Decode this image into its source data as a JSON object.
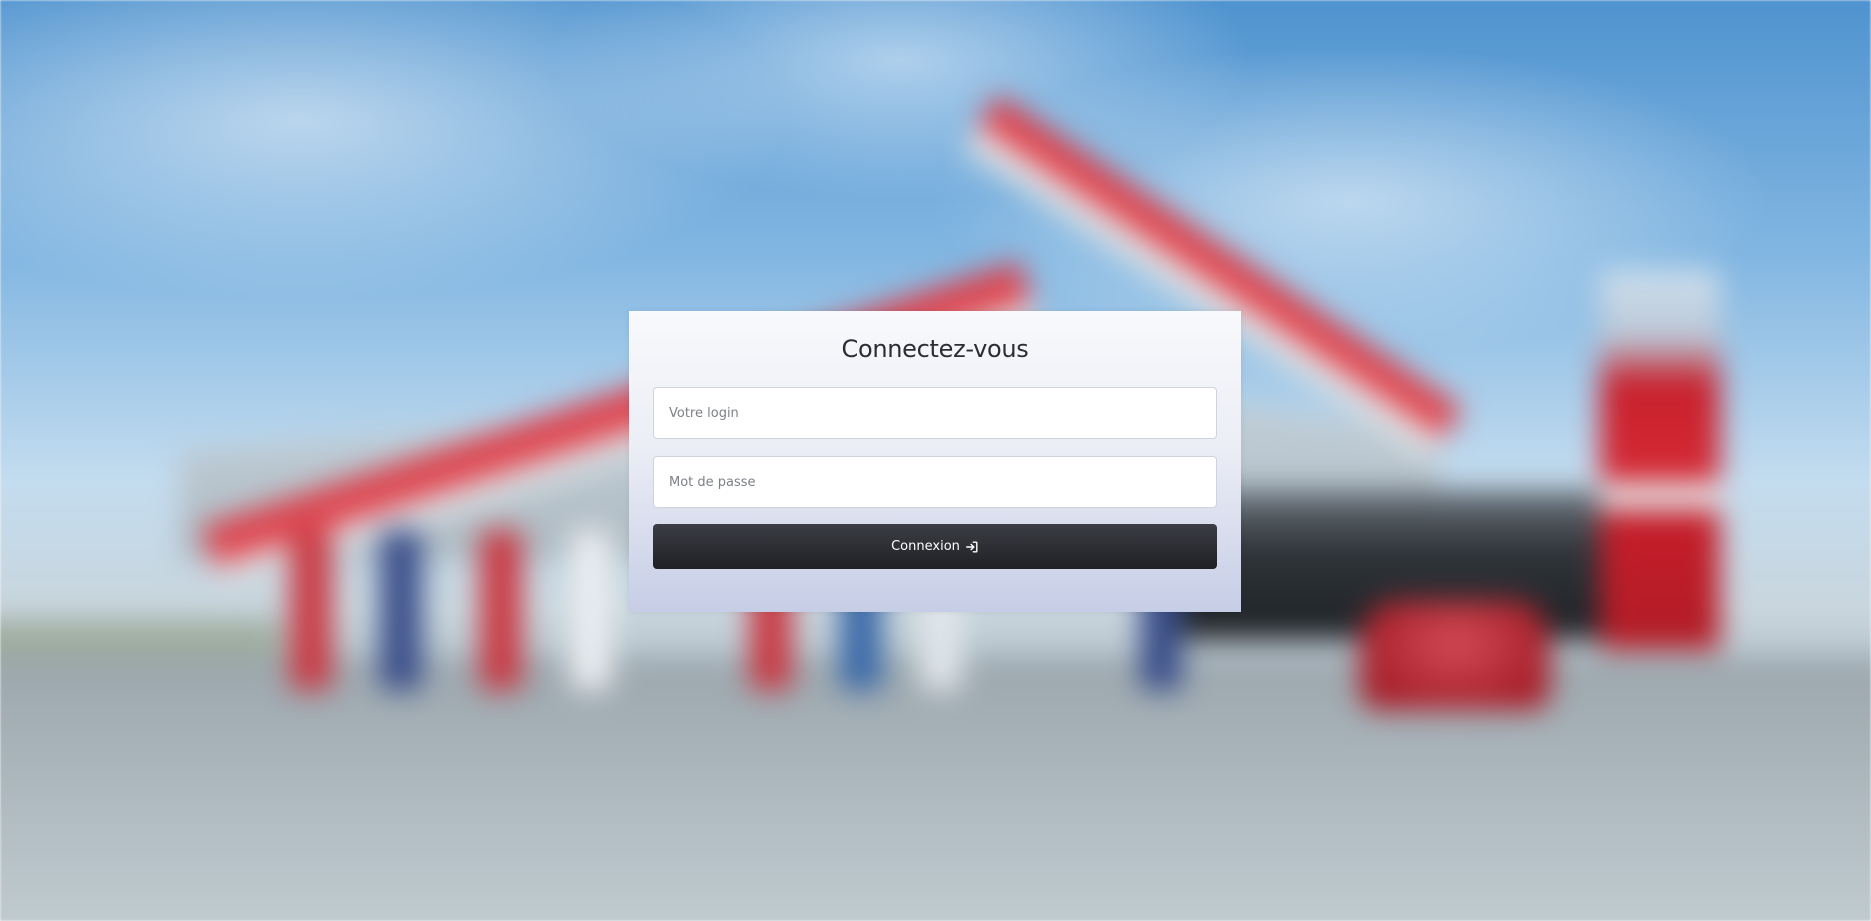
{
  "page": {
    "background_scene": "gas-station"
  },
  "login": {
    "title": "Connectez-vous",
    "login_placeholder": "Votre login",
    "login_value": "",
    "password_placeholder": "Mot de passe",
    "password_value": "",
    "submit_label": "Connexion",
    "submit_icon": "sign-in-icon"
  },
  "colors": {
    "button_bg": "#2a2b31",
    "button_text": "#ffffff",
    "card_top": "#f8f9fc",
    "card_bottom": "#c6cde6",
    "title_text": "#2b2d33"
  }
}
